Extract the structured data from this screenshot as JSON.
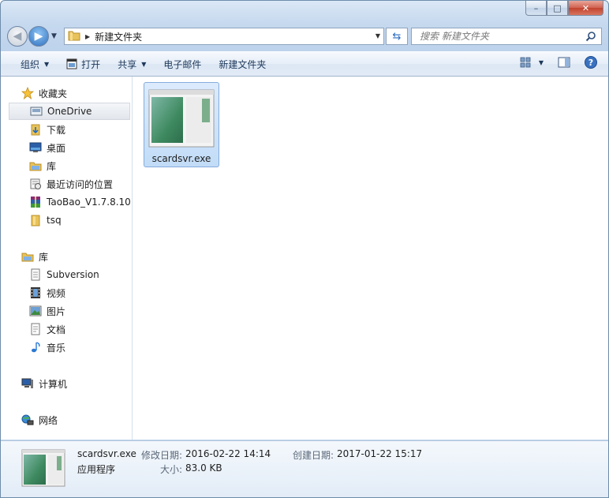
{
  "window": {
    "caption": {
      "minimize": "–",
      "maximize": "□",
      "close": "✕"
    }
  },
  "address": {
    "crumb": "新建文件夹"
  },
  "search": {
    "placeholder": "搜索 新建文件夹"
  },
  "toolbar": {
    "organize": "组织",
    "open": "打开",
    "share": "共享",
    "email": "电子邮件",
    "new_folder": "新建文件夹"
  },
  "nav": {
    "favorites": "收藏夹",
    "onedrive": "OneDrive",
    "downloads": "下载",
    "desktop": "桌面",
    "library_fav": "库",
    "recent": "最近访问的位置",
    "taobao": "TaoBao_V1.7.8.10_",
    "tsq": "tsq",
    "libraries": "库",
    "subversion": "Subversion",
    "videos": "视频",
    "pictures": "图片",
    "documents": "文档",
    "music": "音乐",
    "computer": "计算机",
    "network": "网络"
  },
  "content": {
    "files": [
      {
        "name": "scardsvr.exe"
      }
    ]
  },
  "details": {
    "filename": "scardsvr.exe",
    "type": "应用程序",
    "modified_label": "修改日期:",
    "modified_value": "2016-02-22 14:14",
    "created_label": "创建日期:",
    "created_value": "2017-01-22 15:17",
    "size_label": "大小:",
    "size_value": "83.0 KB"
  },
  "colors": {
    "accent": "#2f70bf",
    "selection": "#c2dcf7",
    "toolbar_text": "#1e395b"
  }
}
